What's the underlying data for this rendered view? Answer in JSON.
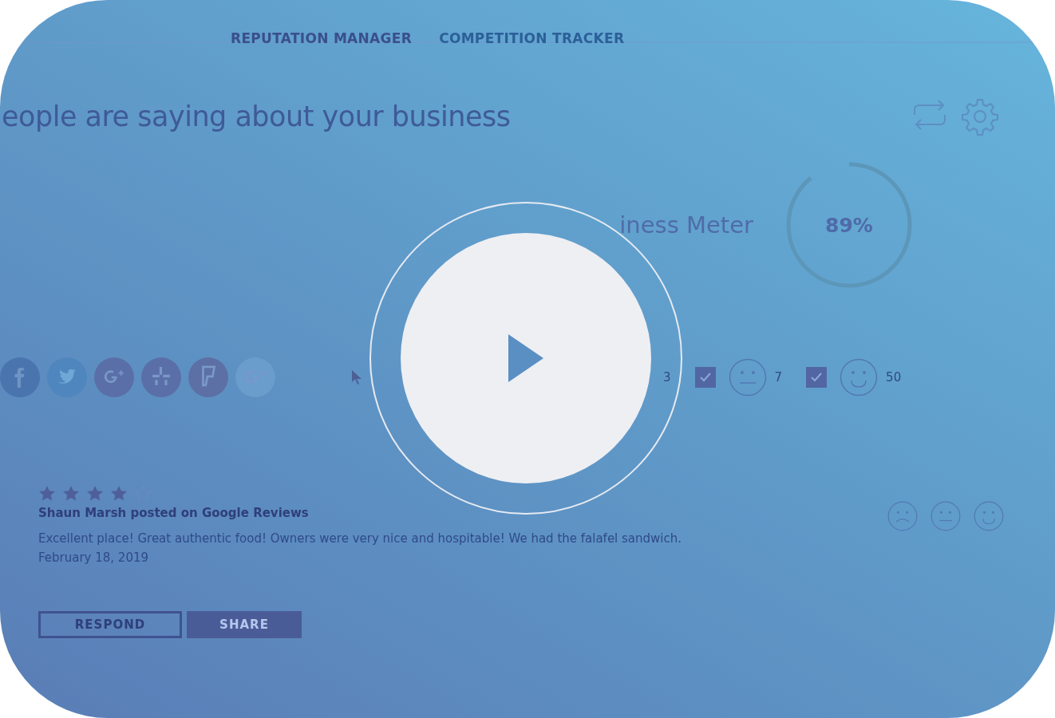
{
  "tabs": [
    {
      "label": "REPUTATION MANAGER",
      "selected": true
    },
    {
      "label": "COMPETITION TRACKER",
      "selected": false
    }
  ],
  "title": "eople are saying about your business",
  "meter": {
    "label": "iness Meter",
    "value": "89%",
    "level": 0.89
  },
  "social": [
    {
      "kind": "facebook",
      "color": "#4a74ae"
    },
    {
      "kind": "twitter",
      "color": "#4f86bd"
    },
    {
      "kind": "gplus",
      "color": "#5a6fa8"
    },
    {
      "kind": "yelp",
      "color": "#5a6fa8"
    },
    {
      "kind": "foursquare",
      "color": "#5c70a6"
    },
    {
      "kind": "gplus",
      "color": "#6a9ccc"
    }
  ],
  "partial_count": "3",
  "filters": [
    {
      "kind": "neutral",
      "checked": true,
      "count": "7"
    },
    {
      "kind": "happy",
      "checked": true,
      "count": "50"
    }
  ],
  "review": {
    "stars": 4,
    "author": "Shaun Marsh posted on Google Reviews",
    "text": "Excellent place! Great authentic food! Owners were very nice and hospitable! We had the falafel sandwich.",
    "date": "February 18, 2019",
    "moods": [
      {
        "kind": "sad"
      },
      {
        "kind": "neutral"
      },
      {
        "kind": "happy"
      }
    ],
    "buttons": [
      {
        "label": "RESPOND",
        "kind": "outline"
      },
      {
        "label": "SHARE",
        "kind": "filled"
      }
    ]
  }
}
